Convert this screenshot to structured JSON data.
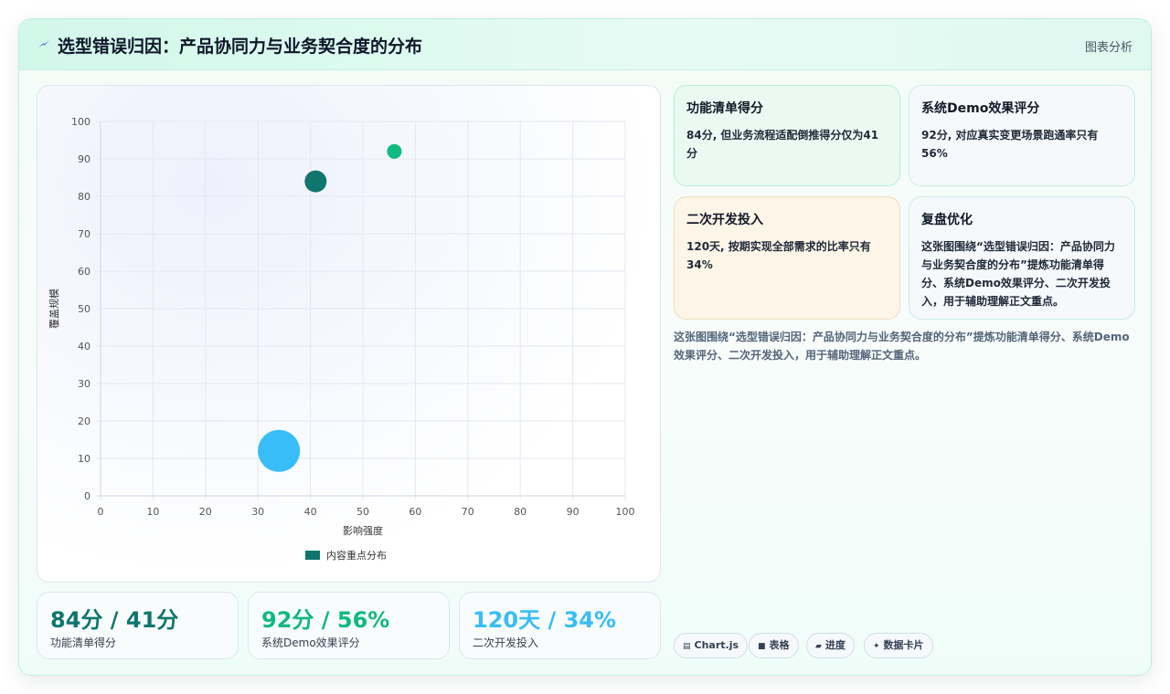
{
  "header": {
    "title": "选型错误归因：产品协同力与业务契合度的分布",
    "tag": "图表分析",
    "icon": "lightning-icon"
  },
  "chart_data": {
    "type": "scatter",
    "xlabel": "影响强度",
    "ylabel": "覆盖规模",
    "xlim": [
      0,
      100
    ],
    "ylim": [
      0,
      100
    ],
    "x_ticks": [
      "0",
      "10",
      "20",
      "30",
      "40",
      "50",
      "60",
      "70",
      "80",
      "90",
      "100"
    ],
    "y_ticks": [
      "0",
      "10",
      "20",
      "30",
      "40",
      "50",
      "60",
      "70",
      "80",
      "90",
      "100"
    ],
    "grid": true,
    "legend_position": "bottom",
    "series": [
      {
        "name": "内容重点分布",
        "color": "#0f766e",
        "points": [
          {
            "x": 41,
            "y": 84,
            "r": 12,
            "color": "#0f766e"
          },
          {
            "x": 56,
            "y": 92,
            "r": 8,
            "color": "#10b981"
          },
          {
            "x": 34,
            "y": 12,
            "r": 23,
            "color": "#38bdf8"
          }
        ]
      }
    ]
  },
  "stats": [
    {
      "value": "84分 / 41分",
      "label": "功能清单得分",
      "color": "#0f766e"
    },
    {
      "value": "92分 / 56%",
      "label": "系统Demo效果评分",
      "color": "#10b981"
    },
    {
      "value": "120天 / 34%",
      "label": "二次开发投入",
      "color": "#38bdf8"
    }
  ],
  "cards": [
    {
      "title": "功能清单得分",
      "body": "84分, 但业务流程适配倒推得分仅为41分"
    },
    {
      "title": "系统Demo效果评分",
      "body": "92分, 对应真实变更场景跑通率只有56%"
    },
    {
      "title": "二次开发投入",
      "body": "120天, 按期实现全部需求的比率只有34%"
    },
    {
      "title": "复盘优化",
      "body": "这张图围绕“选型错误归因：产品协同力与业务契合度的分布”提炼功能清单得分、系统Demo效果评分、二次开发投入，用于辅助理解正文重点。"
    }
  ],
  "summary": "这张图围绕“选型错误归因：产品协同力与业务契合度的分布”提炼功能清单得分、系统Demo效果评分、二次开发投入，用于辅助理解正文重点。",
  "tags": [
    {
      "icon": "▤",
      "label": "Chart.js"
    },
    {
      "icon": "■",
      "label": "表格"
    },
    {
      "icon": "▰",
      "label": "进度"
    },
    {
      "icon": "✦",
      "label": "数据卡片"
    }
  ]
}
